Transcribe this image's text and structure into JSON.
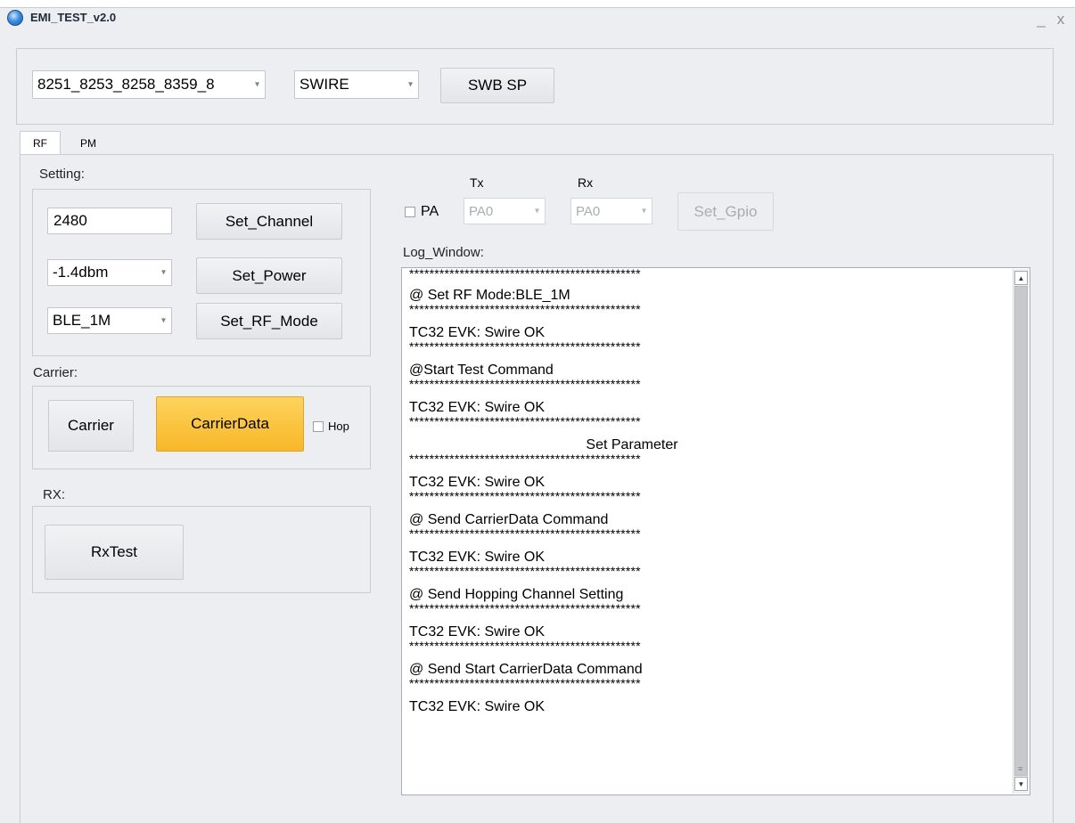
{
  "window": {
    "title": "EMI_TEST_v2.0",
    "minimize_glyph": "_",
    "close_glyph": "x"
  },
  "toolbar": {
    "chip_select": "8251_8253_8258_8359_8",
    "interface_select": "SWIRE",
    "swb_sp_label": "SWB SP"
  },
  "tabs": [
    {
      "label": "RF",
      "selected": true
    },
    {
      "label": "PM",
      "selected": false
    }
  ],
  "setting": {
    "title": "Setting:",
    "channel_value": "2480",
    "set_channel_label": "Set_Channel",
    "power_select": "-1.4dbm",
    "set_power_label": "Set_Power",
    "rf_mode_select": "BLE_1M",
    "set_rf_mode_label": "Set_RF_Mode"
  },
  "carrier": {
    "title": "Carrier:",
    "carrier_label": "Carrier",
    "carrier_data_label": "CarrierData",
    "hop_label": "Hop"
  },
  "rx": {
    "title": "RX:",
    "rx_test_label": "RxTest"
  },
  "gpio": {
    "pa_label": "PA",
    "tx_label": "Tx",
    "rx_label": "Rx",
    "tx_select": "PA0",
    "rx_select": "PA0",
    "set_gpio_label": "Set_Gpio"
  },
  "log": {
    "title": "Log_Window:",
    "stars": "**********************************************",
    "lines": [
      "@ Set RF Mode:BLE_1M",
      "TC32 EVK: Swire OK",
      "@Start Test Command",
      "TC32 EVK: Swire OK",
      "Set Parameter",
      "TC32 EVK: Swire OK",
      "@ Send CarrierData Command",
      "TC32 EVK: Swire OK",
      "@ Send Hopping Channel Setting",
      "TC32 EVK: Swire OK",
      "@ Send Start CarrierData Command",
      "TC32 EVK: Swire OK"
    ]
  }
}
